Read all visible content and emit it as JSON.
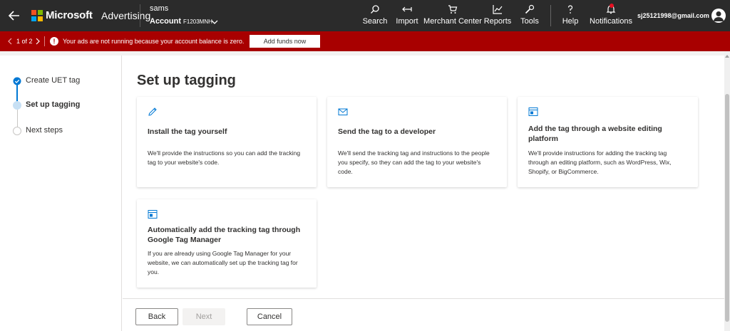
{
  "header": {
    "brand": "Microsoft",
    "product": "Advertising",
    "account_name": "sams",
    "account_label": "Account",
    "account_id": "F1203MNH",
    "nav": [
      {
        "label": "Search",
        "icon": "search-icon"
      },
      {
        "label": "Import",
        "icon": "import-icon"
      },
      {
        "label": "Merchant Center",
        "icon": "cart-icon"
      },
      {
        "label": "Reports",
        "icon": "chart-icon"
      },
      {
        "label": "Tools",
        "icon": "wrench-icon"
      },
      {
        "label": "Help",
        "icon": "question-icon"
      },
      {
        "label": "Notifications",
        "icon": "bell-icon"
      }
    ],
    "user_email": "sj25121998@gmail.com"
  },
  "alert": {
    "pager": "1 of 2",
    "message": "Your ads are not running because your account balance is zero.",
    "action_label": "Add funds now"
  },
  "steps": [
    {
      "label": "Create UET tag",
      "state": "complete"
    },
    {
      "label": "Set up tagging",
      "state": "current"
    },
    {
      "label": "Next steps",
      "state": "pending"
    }
  ],
  "main": {
    "title": "Set up tagging",
    "cards": [
      {
        "icon": "pencil-icon",
        "title": "Install the tag yourself",
        "description": "We'll provide the instructions so you can add the tracking tag to your website's code."
      },
      {
        "icon": "mail-icon",
        "title": "Send the tag to a developer",
        "description": "We'll send the tracking tag and instructions to the people you specify, so they can add the tag to your website's code."
      },
      {
        "icon": "browser-icon",
        "title": "Add the tag through a website editing platform",
        "description": "We'll provide instructions for adding the tracking tag through an editing platform, such as WordPress, Wix, Shopify, or BigCommerce."
      },
      {
        "icon": "browser-icon",
        "title": "Automatically add the tracking tag through Google Tag Manager",
        "description": "If you are already using Google Tag Manager for your website, we can automatically set up the tracking tag for you."
      }
    ]
  },
  "footer": {
    "back_label": "Back",
    "next_label": "Next",
    "cancel_label": "Cancel"
  },
  "colors": {
    "topbar": "#2b2b2b",
    "alert": "#a80000",
    "accent": "#0078d4"
  }
}
